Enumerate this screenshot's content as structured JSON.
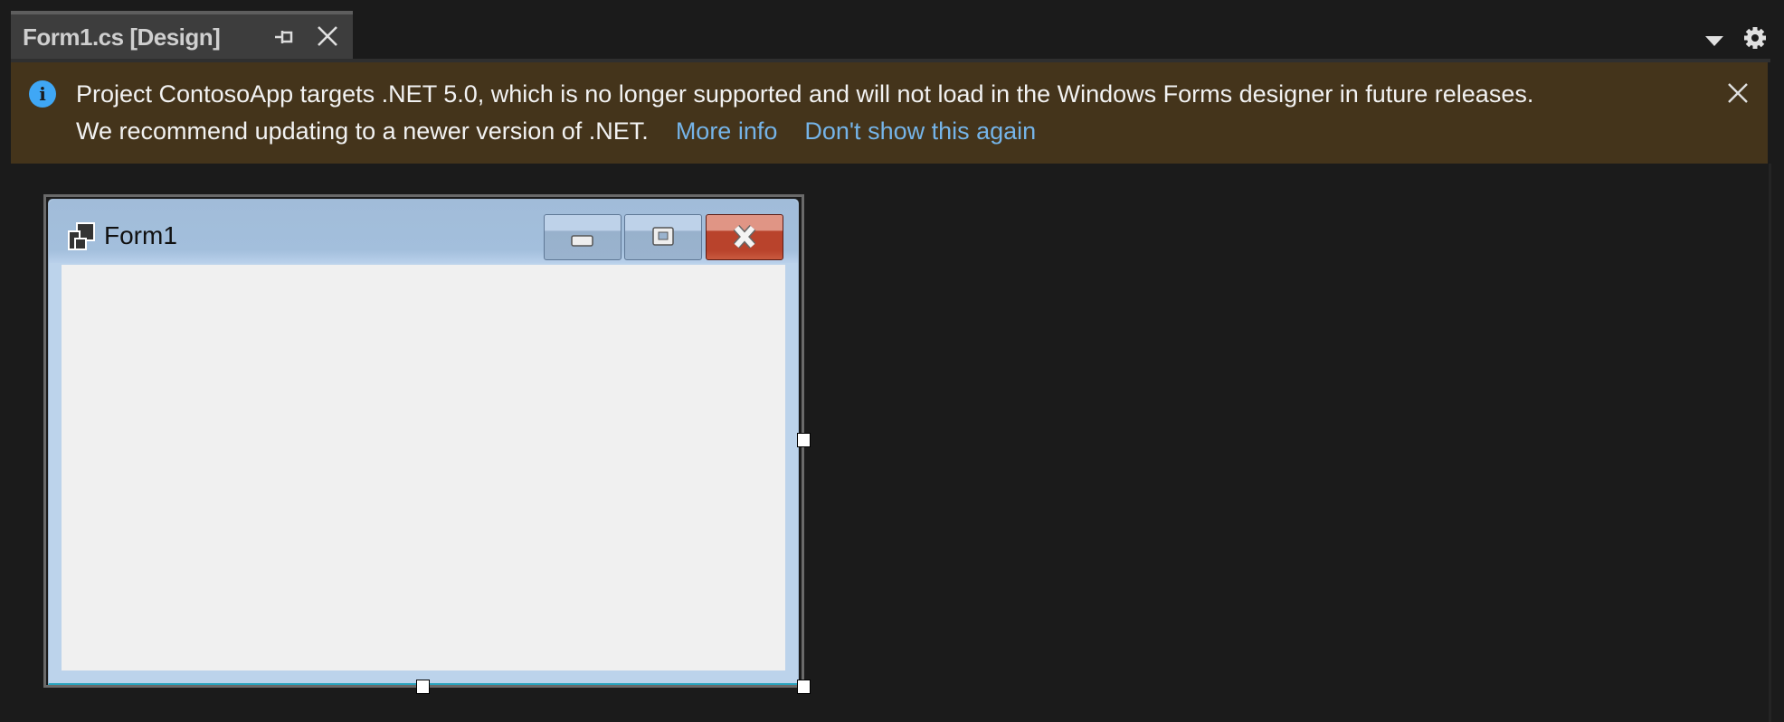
{
  "tab": {
    "title": "Form1.cs [Design]",
    "pin_icon": "pin-icon",
    "close_icon": "close-icon"
  },
  "toolbar": {
    "dropdown_icon": "chevron-down-icon",
    "settings_icon": "gear-icon"
  },
  "banner": {
    "icon": "info-icon",
    "line1": "Project ContosoApp targets .NET 5.0, which is no longer supported and will not load in the Windows Forms designer in future releases.",
    "line2": "We recommend updating to a newer version of .NET.",
    "more_info": "More info",
    "dont_show": "Don't show this again",
    "background": "#44341b",
    "link_color": "#75b4e8"
  },
  "form": {
    "title": "Form1",
    "client_color": "#f0f0f0",
    "close_color": "#b9432c"
  }
}
